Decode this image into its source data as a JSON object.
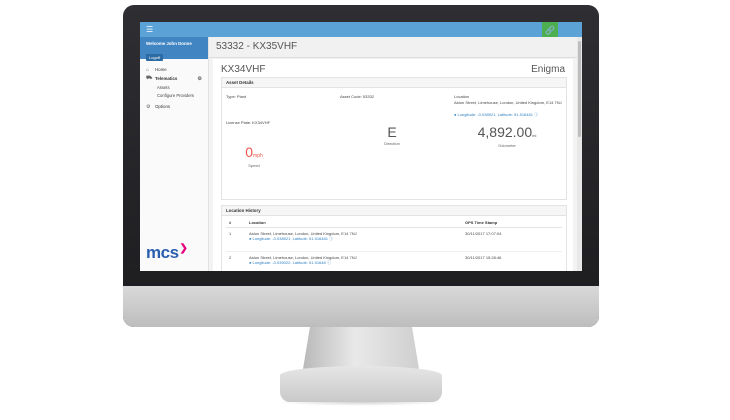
{
  "app": {
    "menu_icon": "hamburger-icon",
    "link_icon": "link-icon"
  },
  "user": {
    "welcome": "Welcome John Donne",
    "logoff": "Logoff"
  },
  "sidebar": {
    "items": [
      {
        "label": "Home",
        "icon": "home-icon"
      },
      {
        "label": "Telematics",
        "icon": "truck-icon"
      },
      {
        "label": "Assets"
      },
      {
        "label": "Configure Providers"
      },
      {
        "label": "Options",
        "icon": "options-icon"
      }
    ],
    "brand": "mcs"
  },
  "page": {
    "title": "53332 - KX35VHF",
    "asset_title": "KX34VHF",
    "provider": "Enigma"
  },
  "asset_details": {
    "heading": "Asset Details",
    "type": "Type: Plant",
    "asset_code": "Asset Code: 53332",
    "location_label": "Location",
    "location_address": "Aston Street, Limehouse, London, United Kingdom, E14 7NJ",
    "location_coords": "Longitude: -0.038921, Latitude: 51.516481",
    "license_plate": "License Plate: KX34VHF",
    "speed": "0",
    "speed_unit": "mph",
    "speed_label": "Speed",
    "direction": "E",
    "direction_label": "Direction",
    "odometer": "4,892.00",
    "odometer_unit": "mi",
    "odometer_label": "Odometer"
  },
  "location_history": {
    "heading": "Location History",
    "columns": [
      "#",
      "Location",
      "GPS Time Stamp"
    ],
    "rows": [
      {
        "num": "1",
        "address": "Aston Street, Limehouse, London, United Kingdom, E14 7NJ",
        "coords": "Longitude: -0.038921, Latitude: 51.516481",
        "time": "30/11/2017 17:07:04"
      },
      {
        "num": "2",
        "address": "Aston Street, Limehouse, London, United Kingdom, E14 7NJ",
        "coords": "Longitude: -0.039022, Latitude: 51.51648",
        "time": "30/11/2017 15:28:46"
      }
    ]
  },
  "colors": {
    "topbar": "#5ba2d6",
    "user_box": "#4186c2",
    "link_button": "#4caf50",
    "speed": "#e8574c",
    "brand_blue": "#2a5fb0",
    "brand_accent": "#e5007e"
  }
}
